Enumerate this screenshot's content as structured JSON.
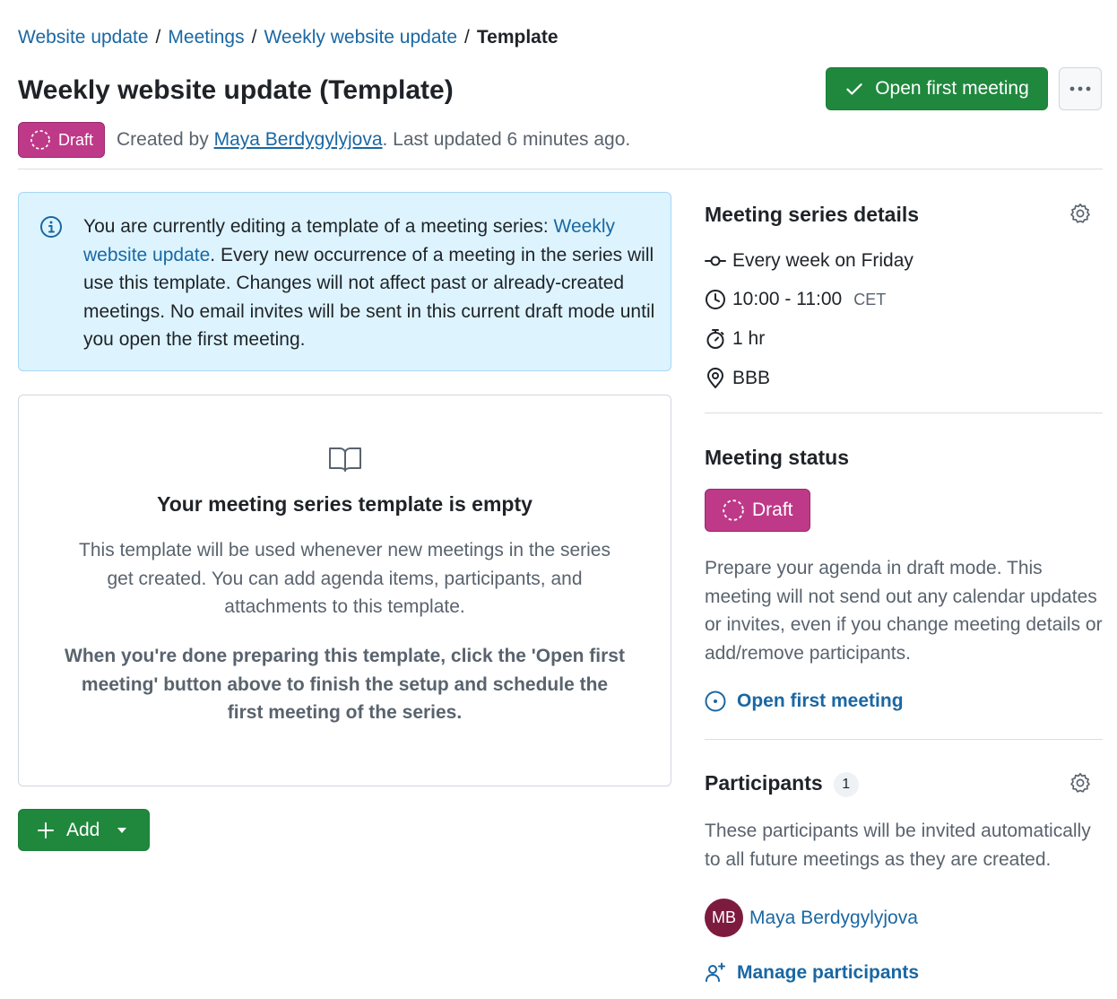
{
  "breadcrumb": {
    "items": [
      "Website update",
      "Meetings",
      "Weekly website update"
    ],
    "separator": "/",
    "current": "Template"
  },
  "header": {
    "title": "Weekly website update (Template)",
    "primary_button": "Open first meeting",
    "more_icon": "kebab-horizontal-icon"
  },
  "meta": {
    "status": "Draft",
    "created_by_prefix": "Created by",
    "author": "Maya Berdygylyjova",
    "last_updated": ". Last updated 6 minutes ago."
  },
  "banner": {
    "text_before": "You are currently editing a template of a meeting series: ",
    "link": "Weekly website update",
    "text_after": ". Every new occurrence of a meeting in the series will use this template. Changes will not affect past or already-created meetings. No email invites will be sent in this current draft mode until you open the first meeting."
  },
  "blankslate": {
    "icon": "book-icon",
    "heading": "Your meeting series template is empty",
    "description": "This template will be used whenever new meetings in the series get created. You can add agenda items, participants, and attachments to this template.",
    "instruction": "When you're done preparing this template, click the 'Open first meeting' button above to finish the setup and schedule the first meeting of the series."
  },
  "add_button": {
    "label": "Add"
  },
  "series_details": {
    "heading": "Meeting series details",
    "recurrence": "Every week on Friday",
    "time": "10:00 - 11:00",
    "timezone": "CET",
    "duration": "1 hr",
    "location": "BBB"
  },
  "status_section": {
    "heading": "Meeting status",
    "status": "Draft",
    "description": "Prepare your agenda in draft mode. This meeting will not send out any calendar updates or invites, even if you change meeting details or add/remove participants.",
    "action": "Open first meeting"
  },
  "participants_section": {
    "heading": "Participants",
    "count": "1",
    "description": "These participants will be invited automatically to all future meetings as they are created.",
    "participant": {
      "initials": "MB",
      "name": "Maya Berdygylyjova"
    },
    "manage": "Manage participants"
  },
  "colors": {
    "primary_green": "#1f883d",
    "draft_pink": "#bf3989",
    "link_blue": "#1a67a3",
    "info_bg": "#ddf4ff",
    "avatar": "#7d1b3f"
  }
}
